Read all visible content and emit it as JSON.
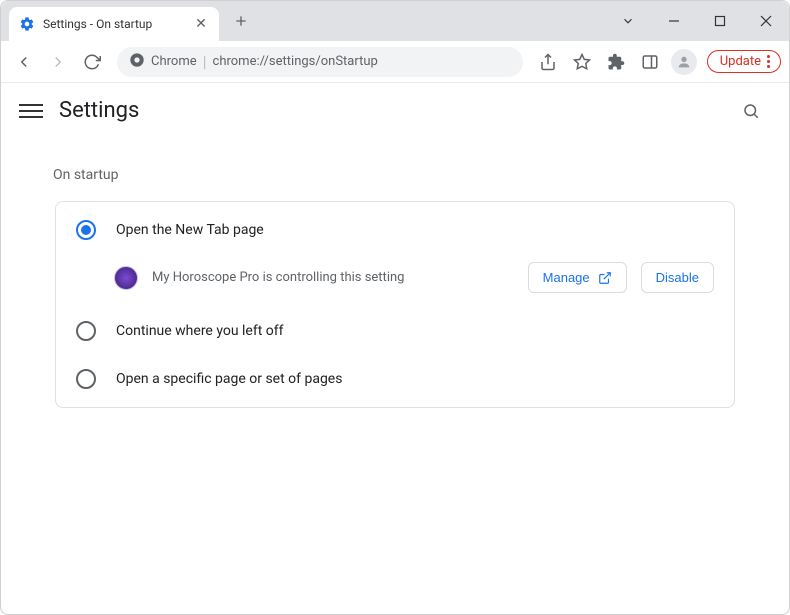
{
  "tab": {
    "title": "Settings - On startup"
  },
  "toolbar": {
    "omnibox_chip": "Chrome",
    "omnibox_url": "chrome://settings/onStartup",
    "update_label": "Update"
  },
  "header": {
    "title": "Settings"
  },
  "section": {
    "title": "On startup",
    "options": [
      {
        "label": "Open the New Tab page"
      },
      {
        "label": "Continue where you left off"
      },
      {
        "label": "Open a specific page or set of pages"
      }
    ],
    "controlled": {
      "text": "My Horoscope Pro is controlling this setting",
      "manage_label": "Manage",
      "disable_label": "Disable"
    }
  }
}
